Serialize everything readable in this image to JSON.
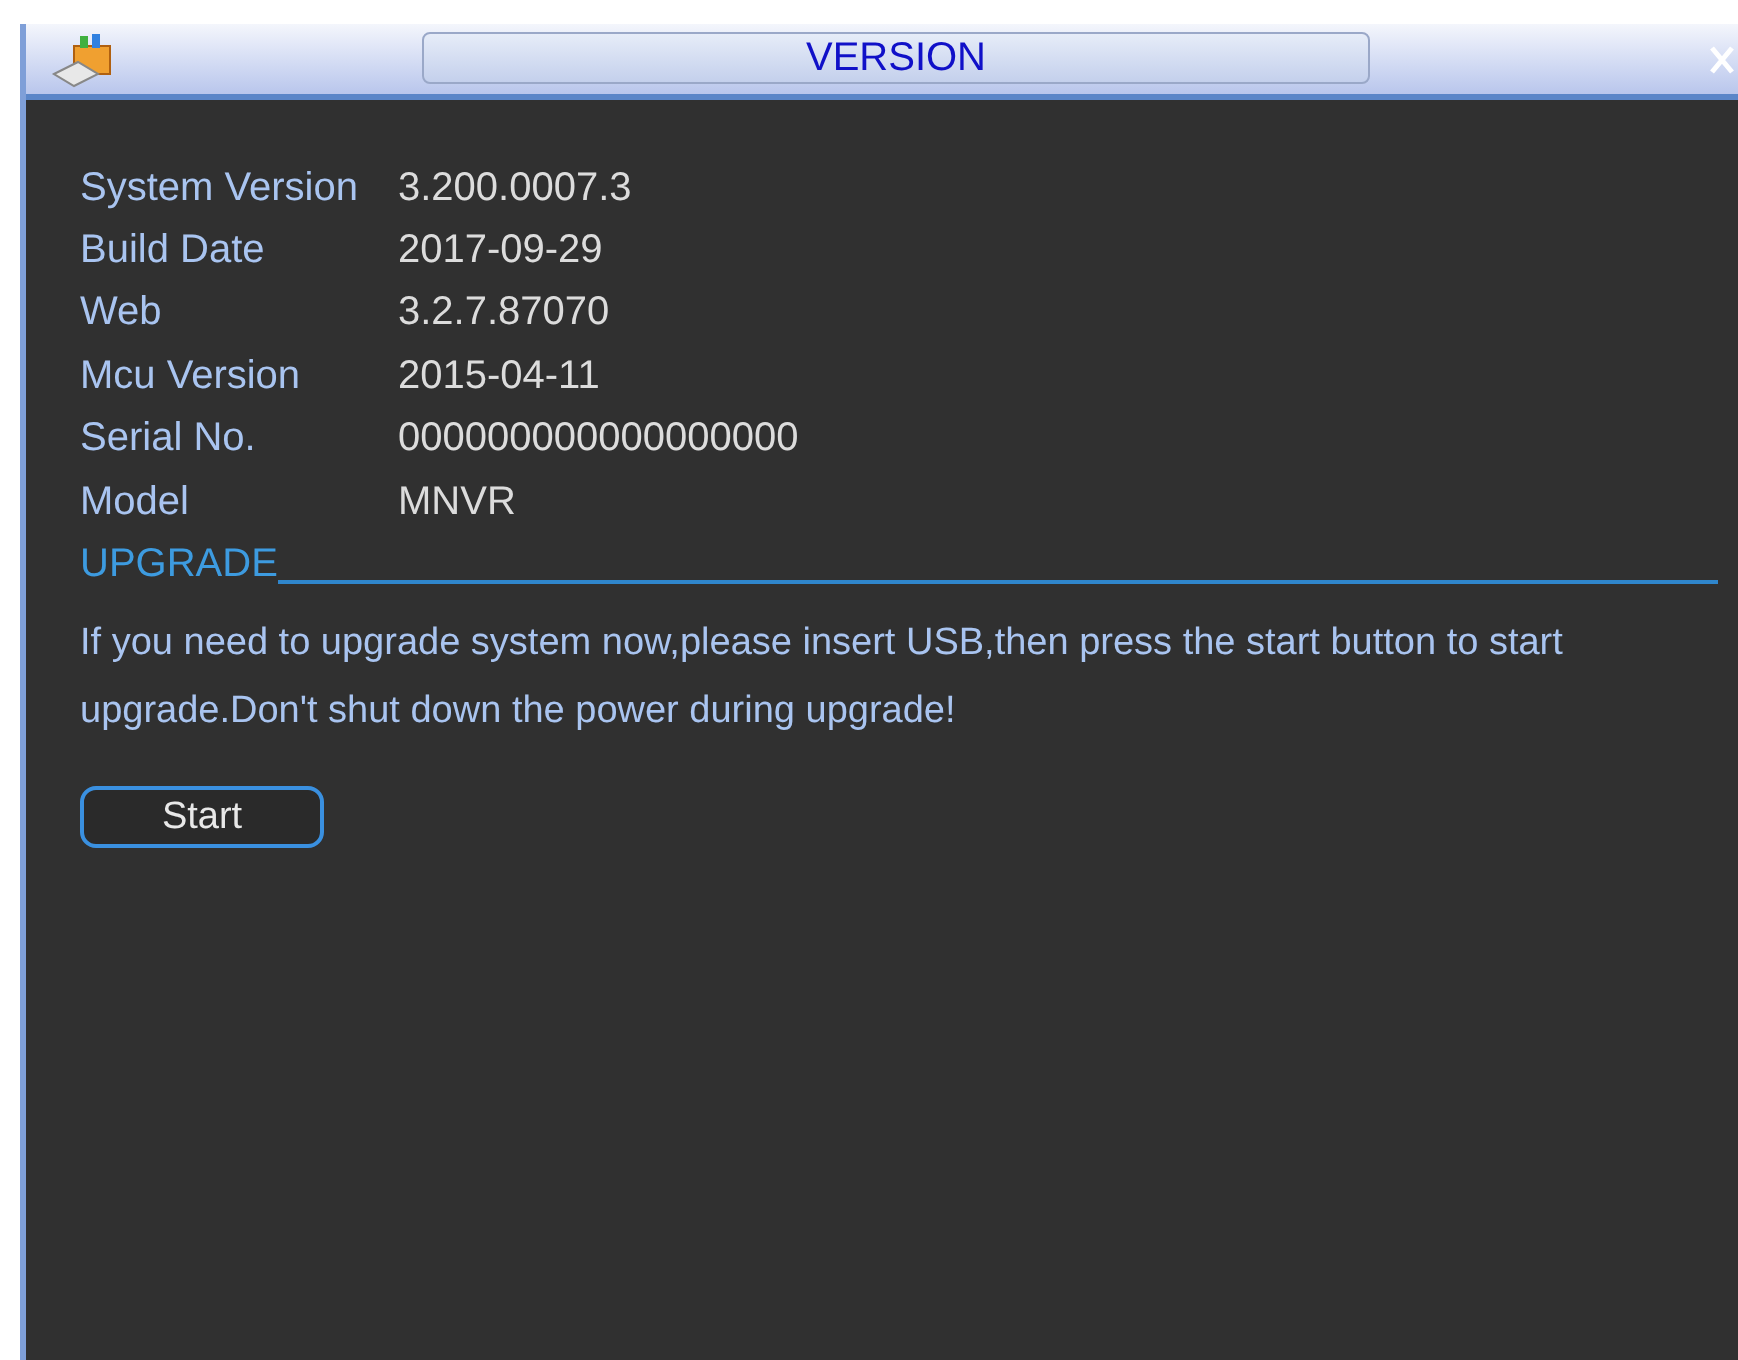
{
  "window": {
    "title": "VERSION"
  },
  "info": [
    {
      "label": "System Version",
      "value": "3.200.0007.3"
    },
    {
      "label": "Build Date",
      "value": "2017-09-29"
    },
    {
      "label": "Web",
      "value": "3.2.7.87070"
    },
    {
      "label": "Mcu Version",
      "value": "2015-04-11"
    },
    {
      "label": "Serial No.",
      "value": "000000000000000000"
    },
    {
      "label": "Model",
      "value": "MNVR"
    }
  ],
  "upgrade": {
    "heading": "UPGRADE",
    "message": "If you need to upgrade system now,please insert USB,then press the start button to start upgrade.Don't shut down the power during upgrade!",
    "button": "Start"
  }
}
